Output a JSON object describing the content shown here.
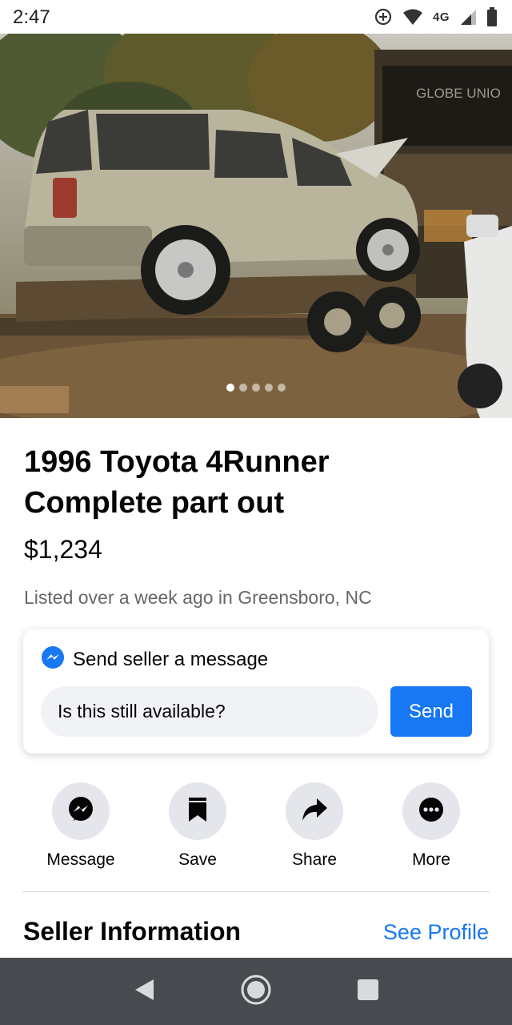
{
  "status_bar": {
    "time": "2:47",
    "network": "4G",
    "icons": [
      "data-saver-icon",
      "wifi-icon",
      "signal-icon",
      "battery-icon"
    ]
  },
  "listing": {
    "photo": {
      "description_icon": "vehicle-photo",
      "sign_text": "GLOBE UNIO",
      "carousel_count": 5,
      "carousel_active": 1
    },
    "title": "1996 Toyota 4Runner Complete part out",
    "price": "$1,234",
    "listed": "Listed over a week ago in Greensboro, NC"
  },
  "message_card": {
    "header": "Send seller a message",
    "header_icon": "messenger-icon",
    "input_value": "Is this still available?",
    "send_label": "Send"
  },
  "actions": [
    {
      "label": "Message",
      "icon": "messenger-icon"
    },
    {
      "label": "Save",
      "icon": "bookmark-icon"
    },
    {
      "label": "Share",
      "icon": "share-arrow-icon"
    },
    {
      "label": "More",
      "icon": "more-dots-icon"
    }
  ],
  "seller": {
    "title": "Seller Information",
    "link": "See Profile"
  },
  "nav_bar": {
    "icons": [
      "back-icon",
      "home-icon",
      "recents-icon"
    ]
  },
  "colors": {
    "accent": "#1877f2",
    "secondary_text": "#65676b",
    "nav_background": "#474a4e",
    "action_circle": "#e4e6eb"
  }
}
